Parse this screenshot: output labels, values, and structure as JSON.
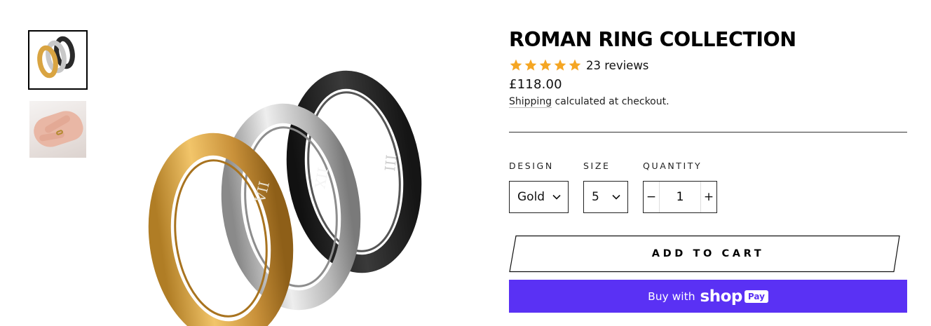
{
  "product": {
    "title": "ROMAN RING COLLECTION",
    "rating_stars": 5,
    "reviews_label": "23 reviews",
    "price": "£118.00",
    "shipping_link": "Shipping",
    "shipping_text": " calculated at checkout."
  },
  "gallery": {
    "thumbnails": [
      "rings-thumbnail",
      "hand-ring-thumbnail"
    ],
    "main_image": "roman-rings-gold-silver-black"
  },
  "options": {
    "design_label": "DESIGN",
    "design_value": "Gold",
    "size_label": "SIZE",
    "size_value": "5",
    "quantity_label": "QUANTITY",
    "quantity_value": "1",
    "minus": "−",
    "plus": "+"
  },
  "actions": {
    "add_to_cart": "ADD TO CART",
    "buy_with": "Buy with",
    "shop": "shop",
    "pay": "Pay"
  },
  "colors": {
    "star": "#f5a623",
    "shop_pay": "#5a31f4",
    "gold": "#d9a441",
    "silver": "#c9c9c9",
    "black": "#2a2a2a"
  }
}
